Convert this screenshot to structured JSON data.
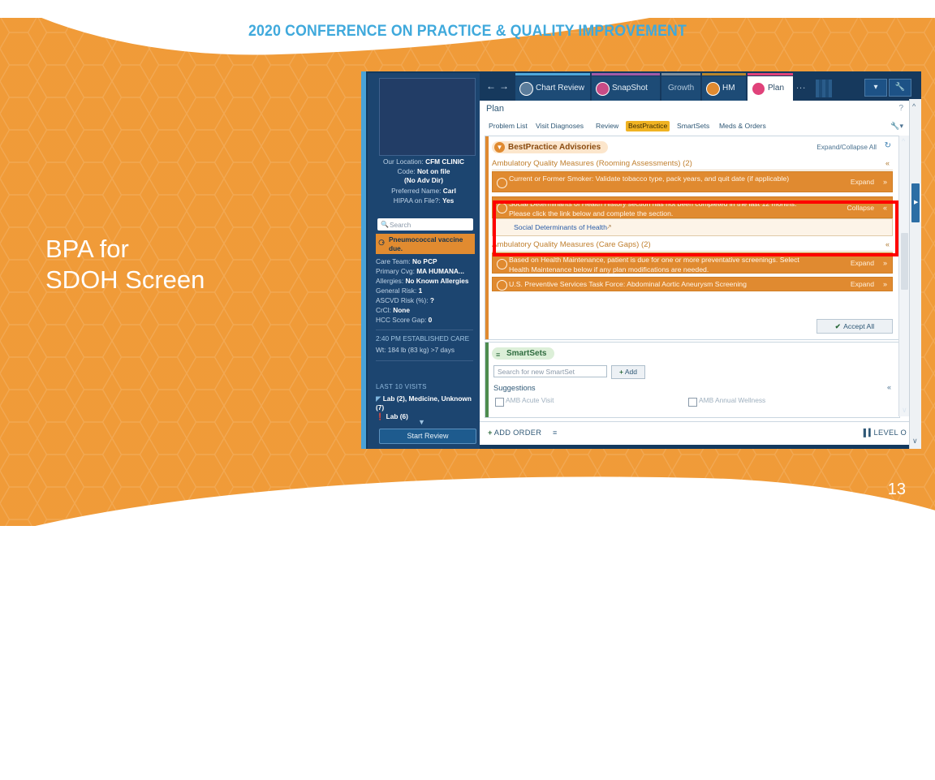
{
  "slide": {
    "conference_header": "2020 CONFERENCE ON PRACTICE & QUALITY IMPROVEMENT",
    "title_line1": "BPA for",
    "title_line2": "SDOH Screen",
    "page_number": "13",
    "accent_orange": "#EE9125",
    "accent_blue": "#3FA9DC"
  },
  "epic": {
    "toolbar": {
      "back_arrow": "←",
      "forward_arrow": "→",
      "tabs": [
        {
          "label": "Chart Review",
          "icon": "chart-review-icon",
          "accent": "#4FA8DC",
          "active": false
        },
        {
          "label": "SnapShot",
          "icon": "snapshot-icon",
          "accent": "#A05BA8",
          "active": false
        },
        {
          "label": "Growth",
          "icon": "",
          "accent": "#7E8E9C",
          "active": false
        },
        {
          "label": "HM",
          "icon": "hm-icon",
          "accent": "#B7862E",
          "active": false
        },
        {
          "label": "Plan",
          "icon": "plan-icon",
          "accent": "#E0427A",
          "active": true
        }
      ],
      "more_tabs": "...",
      "dropdown_label": "▾",
      "wrench_label": "🔧"
    },
    "workspace": {
      "title": "Plan",
      "help_icon": "?",
      "subtabs": [
        {
          "label": "Problem List",
          "selected": false
        },
        {
          "label": "Visit Diagnoses",
          "selected": false
        },
        {
          "label": "Review",
          "selected": false
        },
        {
          "label": "BestPractice",
          "selected": true
        },
        {
          "label": "SmartSets",
          "selected": false
        },
        {
          "label": "Meds & Orders",
          "selected": false
        }
      ],
      "tools_icon": "wrench-dropdown-icon"
    },
    "sidebar": {
      "photo_placeholder": "patient-photo",
      "info_lines": [
        {
          "label": "Our Location:",
          "value": "CFM CLINIC"
        },
        {
          "label": "Code:",
          "value": "Not on file"
        },
        {
          "label": "",
          "value": "(No Adv Dir)"
        },
        {
          "label": "Preferred Name:",
          "value": "Carl"
        },
        {
          "label": "HIPAA on File?:",
          "value": "Yes"
        }
      ],
      "search_placeholder": "Search",
      "alert": "Pneumococcal vaccine due.",
      "details": [
        {
          "label": "Care Team:",
          "value": "No PCP"
        },
        {
          "label": "Primary Cvg:",
          "value": "MA HUMANA..."
        },
        {
          "label": "Allergies:",
          "value": "No Known Allergies"
        },
        {
          "label": "General Risk:",
          "value": "1"
        },
        {
          "label": "ASCVD Risk (%):",
          "value": "?"
        },
        {
          "label": "CrCl:",
          "value": "None"
        },
        {
          "label": "HCC Score Gap:",
          "value": "0"
        }
      ],
      "appointment": "2:40 PM ESTABLISHED CARE",
      "weight": "Wt: 184 lb (83 kg) >7 days",
      "visits_header": "LAST 10 VISITS",
      "visits": [
        {
          "icon": "lab-icon",
          "text": "Lab (2), Medicine, Unknown (7)"
        },
        {
          "icon": "alert-icon",
          "text": "Lab (6)"
        }
      ],
      "start_review_label": "Start Review"
    },
    "bpa": {
      "section_title": "BestPractice Advisories",
      "expand_collapse_all": "Expand/Collapse All",
      "refresh_icon": "refresh-icon",
      "groups": [
        {
          "title": "Ambulatory Quality Measures (Rooming Assessments) (2)",
          "advisories": [
            {
              "text": "Current or Former Smoker: Validate tobacco type, pack years, and quit date (if applicable)",
              "action": "Expand",
              "chevron": "»",
              "highlighted": false
            },
            {
              "text": "Social Determinants of Health History section has not been completed in the last 12 months. Please click the link below and complete the section.",
              "action": "Collapse",
              "chevron": "«",
              "highlighted": true,
              "link": "Social Determinants of Health"
            }
          ]
        },
        {
          "title": "Ambulatory Quality Measures (Care Gaps) (2)",
          "advisories": [
            {
              "text": "Based on Health Maintenance, patient is due for one or more preventative screenings. Select Health Maintenance below if any plan modifications are needed.",
              "action": "Expand",
              "chevron": "»",
              "highlighted": false
            },
            {
              "text": "U.S. Preventive Services Task Force: Abdominal Aortic Aneurysm Screening",
              "action": "Expand",
              "chevron": "»",
              "highlighted": false
            }
          ]
        }
      ],
      "accept_all_label": "Accept All",
      "accept_all_check": "✔"
    },
    "smartsets": {
      "section_title": "SmartSets",
      "section_icon": "smartset-icon",
      "search_placeholder": "Search for new SmartSet",
      "add_label": "Add",
      "add_plus": "+",
      "suggestions_label": "Suggestions",
      "suggestion_left": "AMB Acute Visit",
      "suggestion_right": "AMB Annual Wellness"
    },
    "orderbar": {
      "add_order_label": "ADD ORDER",
      "add_order_plus": "+",
      "order_list_icon": "order-list-icon",
      "level_label": "LEVEL O",
      "level_icon": "level-bars-icon"
    }
  }
}
